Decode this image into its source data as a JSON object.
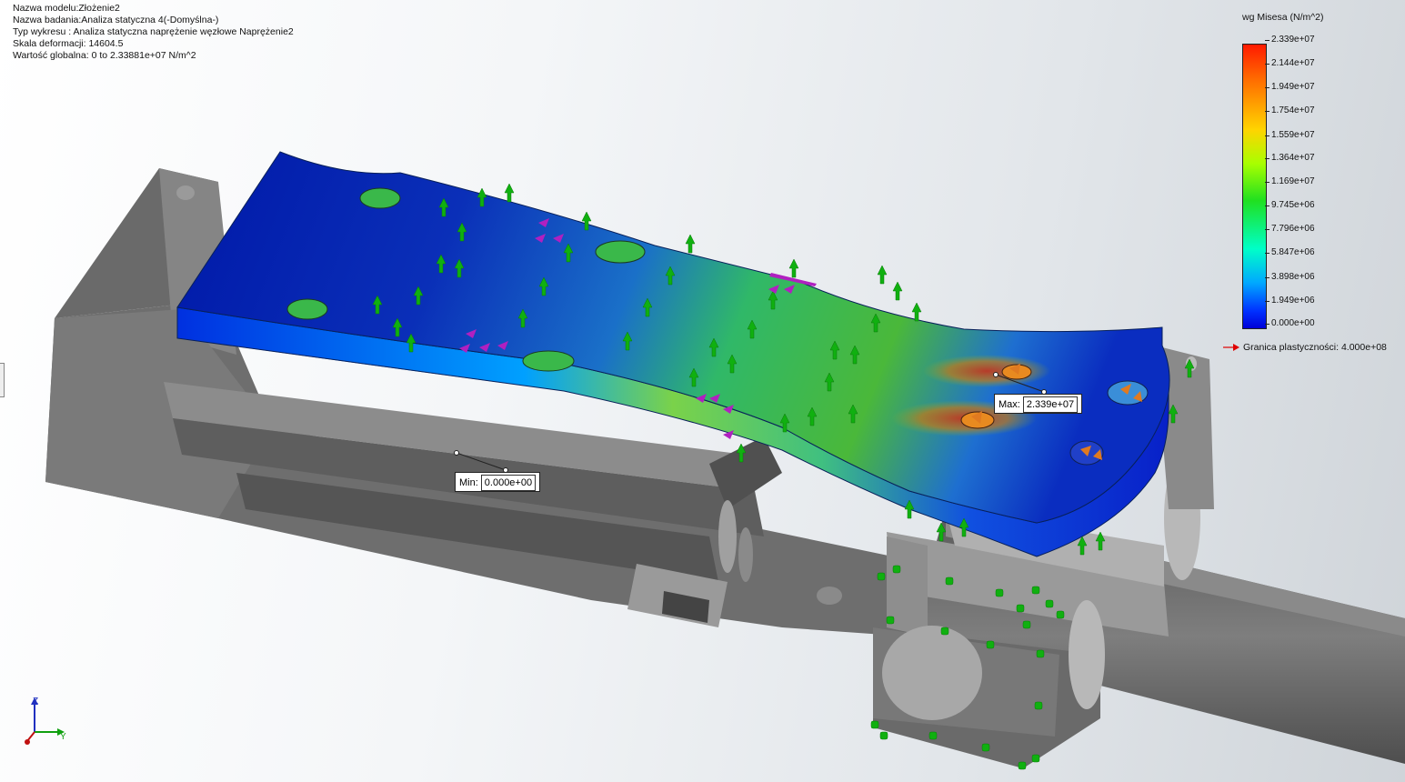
{
  "study_info": {
    "model_name": "Nazwa modelu:Złożenie2",
    "study_name": "Nazwa badania:Analiza statyczna 4(-Domyślna-)",
    "plot_type": "Typ wykresu : Analiza statyczna naprężenie węzłowe Naprężenie2",
    "deformation_scale": "Skala deformacji: 14604.5",
    "global_value": "Wartość globalna: 0 to 2.33881e+07 N/m^2"
  },
  "legend": {
    "title": "wg Misesa (N/m^2)",
    "ticks": [
      "2.339e+07",
      "2.144e+07",
      "1.949e+07",
      "1.754e+07",
      "1.559e+07",
      "1.364e+07",
      "1.169e+07",
      "9.745e+06",
      "7.796e+06",
      "5.847e+06",
      "3.898e+06",
      "1.949e+06",
      "0.000e+00"
    ],
    "yield_label": "Granica plastyczności: 4.000e+08",
    "yield_arrow_color": "#e00000"
  },
  "probes": {
    "max": {
      "label": "Max:",
      "value": "2.339e+07"
    },
    "min": {
      "label": "Min:",
      "value": "0.000e+00"
    }
  },
  "triad": {
    "x": "Y",
    "z": "Z"
  },
  "colors": {
    "stress_max": "#ff1a00",
    "stress_min": "#0000d8",
    "load_arrow": "#10b010",
    "force_arrow": "#b020c0",
    "fixture": "#e07a20",
    "assembly_gray": "#7a7a7a"
  }
}
